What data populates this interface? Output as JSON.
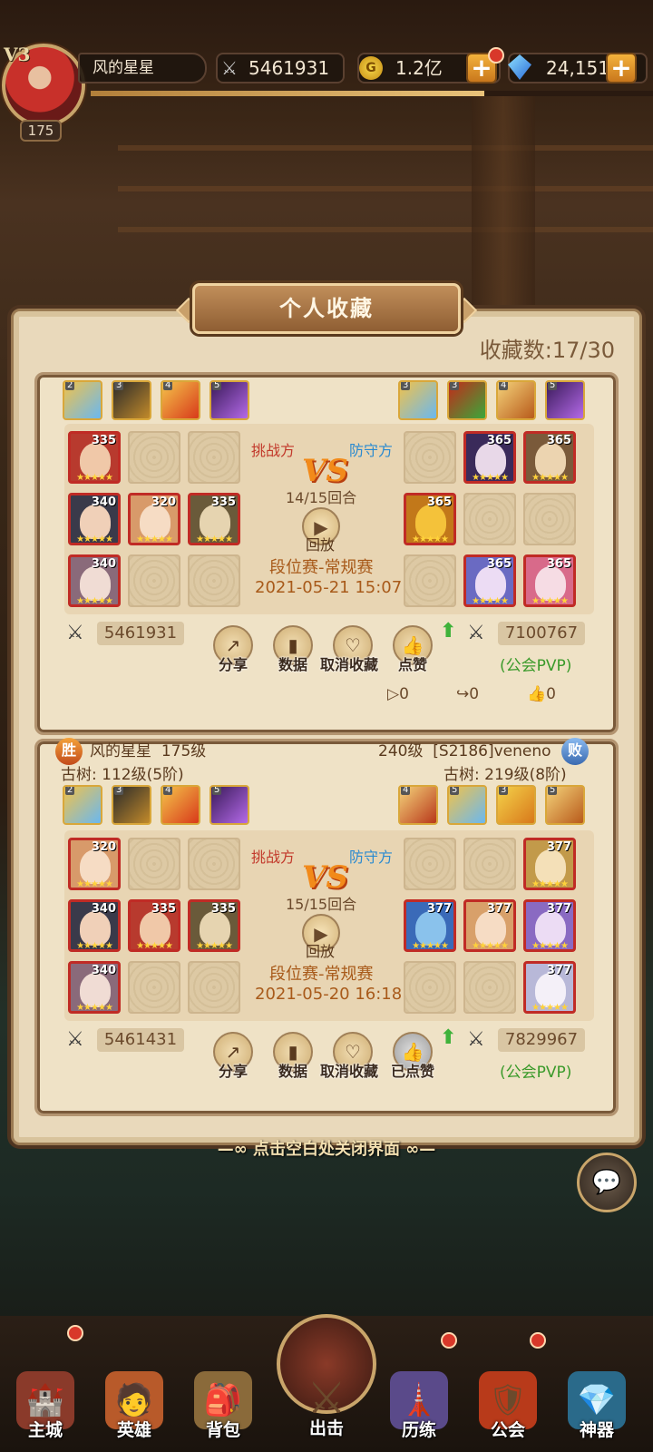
{
  "topbar": {
    "vip": "V3",
    "player_name": "风的星星",
    "level": "175",
    "power": "5461931",
    "gold": "1.2亿",
    "gems": "24,151"
  },
  "panel": {
    "title": "个人收藏",
    "count_label": "收藏数:17/30"
  },
  "labels": {
    "challenger": "挑战方",
    "defender": "防守方",
    "vs": "VS",
    "replay": "回放",
    "share": "分享",
    "data": "数据",
    "unfavorite": "取消收藏",
    "like": "点赞",
    "liked": "已点赞",
    "guild_pvp": "(公会PVP)"
  },
  "records": [
    {
      "rounds": "14/15回合",
      "mode": "段位赛-常规赛",
      "date": "2021-05-21 15:07",
      "left_power": "5461931",
      "right_power": "7100767",
      "stats": {
        "views": "0",
        "shares": "0",
        "likes": "0"
      },
      "left_artifacts": [
        "2",
        "3",
        "4",
        "5"
      ],
      "right_artifacts": [
        "3",
        "3",
        "4",
        "5"
      ],
      "left_heroes": [
        "335",
        "340",
        "320",
        "335",
        "340"
      ],
      "right_heroes": [
        "365",
        "365",
        "365",
        "365",
        "365"
      ]
    },
    {
      "left_name": "风的星星",
      "left_level": "175级",
      "left_tree": "古树: 112级(5阶)",
      "left_result": "胜",
      "right_level": "240级",
      "right_name": "[S2186]veneno",
      "right_tree": "古树: 219级(8阶)",
      "right_result": "败",
      "rounds": "15/15回合",
      "mode": "段位赛-常规赛",
      "date": "2021-05-20 16:18",
      "left_power": "5461431",
      "right_power": "7829967",
      "left_artifacts": [
        "2",
        "3",
        "4",
        "5"
      ],
      "right_artifacts": [
        "4",
        "5",
        "3",
        "5"
      ],
      "left_heroes": [
        "320",
        "340",
        "335",
        "335",
        "340"
      ],
      "right_heroes": [
        "377",
        "377",
        "377",
        "377",
        "377"
      ]
    }
  ],
  "hint": "点击空白处关闭界面",
  "nav": [
    {
      "label": "主城"
    },
    {
      "label": "英雄"
    },
    {
      "label": "背包"
    },
    {
      "label": "出击"
    },
    {
      "label": "历练"
    },
    {
      "label": "公会"
    },
    {
      "label": "神器"
    }
  ]
}
